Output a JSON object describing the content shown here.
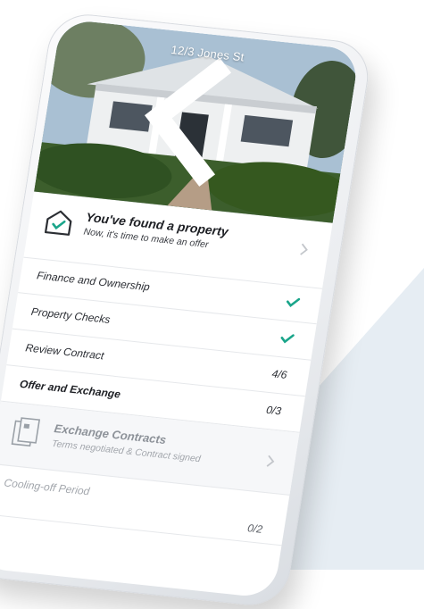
{
  "header": {
    "address": "12/3 Jones St"
  },
  "hero": {
    "title": "You've found a property",
    "subtitle": "Now, it's time to make an offer"
  },
  "rows": [
    {
      "label": "Finance and Ownership",
      "status": "check-icon"
    },
    {
      "label": "Property Checks",
      "status": "check-icon"
    },
    {
      "label": "Review Contract",
      "value": "4/6"
    },
    {
      "label": "Offer and Exchange",
      "value": "0/3"
    }
  ],
  "step": {
    "title": "Exchange Contracts",
    "subtitle": "Terms negotiated & Contract signed"
  },
  "cooling": {
    "label": "Cooling-off Period",
    "value": "0/2"
  },
  "colors": {
    "accent": "#1aa58a",
    "background_wedge": "#e6edf3"
  }
}
